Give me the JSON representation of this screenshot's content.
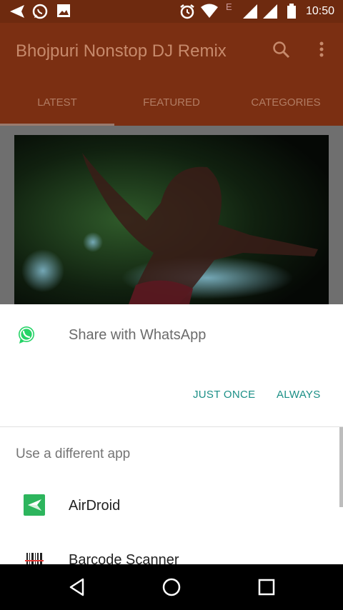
{
  "status_bar": {
    "time": "10:50",
    "network_label": "E",
    "left_icons": [
      "send-icon",
      "whatsapp-icon",
      "gallery-icon"
    ],
    "right_icons": [
      "alarm-icon",
      "wifi-icon",
      "signal-icon",
      "signal-icon",
      "battery-icon"
    ]
  },
  "app_bar": {
    "title": "Bhojpuri Nonstop DJ Remix",
    "icons": [
      "search-icon",
      "more-vert-icon"
    ],
    "tabs": [
      {
        "label": "LATEST",
        "selected": true
      },
      {
        "label": "FEATURED",
        "selected": false
      },
      {
        "label": "CATEGORIES",
        "selected": false
      }
    ]
  },
  "share_sheet": {
    "share_label": "Share with WhatsApp",
    "just_once_label": "JUST ONCE",
    "always_label": "ALWAYS",
    "section_title": "Use a different app",
    "apps": [
      {
        "label": "AirDroid",
        "icon": "airdroid-icon"
      },
      {
        "label": "Barcode Scanner",
        "icon": "barcode-icon"
      }
    ]
  },
  "nav_bar": {
    "buttons": [
      "back-icon",
      "home-icon",
      "recents-icon"
    ]
  },
  "colors": {
    "status_bar": "#6e2a0f",
    "app_bar": "#7b2f12",
    "accent": "#1b8f86",
    "whatsapp_green": "#25d366",
    "airdroid_green": "#2db55d"
  }
}
